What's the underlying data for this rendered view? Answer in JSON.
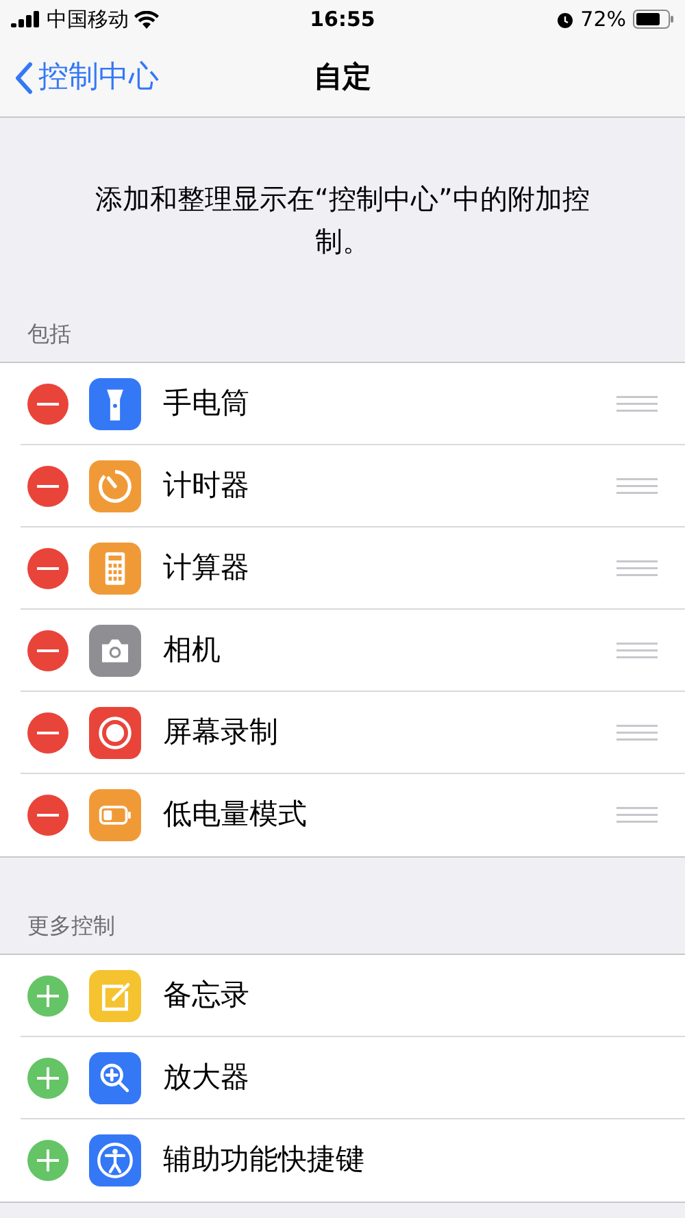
{
  "status_bar": {
    "carrier": "中国移动",
    "time": "16:55",
    "battery": "72%"
  },
  "nav": {
    "back": "控制中心",
    "title": "自定"
  },
  "description": "添加和整理显示在“控制中心”中的附加控制。",
  "sections": [
    {
      "header": "包括",
      "kind": "remove",
      "reorderable": true,
      "items": [
        {
          "label": "手电筒"
        },
        {
          "label": "计时器"
        },
        {
          "label": "计算器"
        },
        {
          "label": "相机"
        },
        {
          "label": "屏幕录制"
        },
        {
          "label": "低电量模式"
        }
      ]
    },
    {
      "header": "更多控制",
      "kind": "add",
      "reorderable": false,
      "items": [
        {
          "label": "备忘录"
        },
        {
          "label": "放大器"
        },
        {
          "label": "辅助功能快捷键"
        }
      ]
    }
  ]
}
